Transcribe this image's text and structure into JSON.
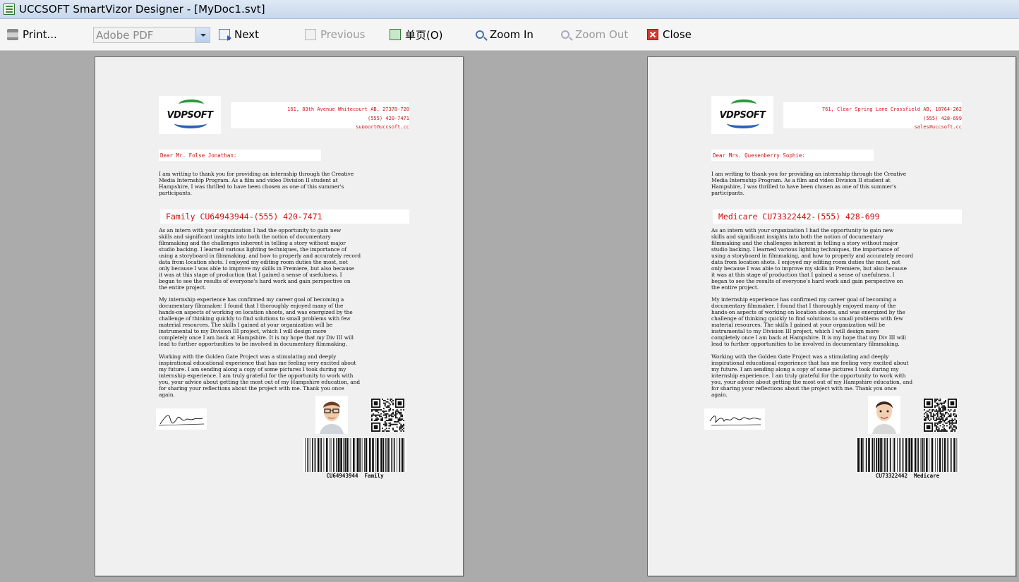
{
  "window": {
    "title": "UCCSOFT SmartVizor Designer - [MyDoc1.svt]"
  },
  "toolbar": {
    "print_label": "Print...",
    "printer_value": "Adobe PDF",
    "next_label": "Next",
    "previous_label": "Previous",
    "single_page_label": "单页(O)",
    "zoom_in_label": "Zoom In",
    "zoom_out_label": "Zoom Out",
    "close_label": "Close"
  },
  "letter": {
    "logo_text": "VDPSOFT",
    "para1": "I am writing to thank you for providing an internship through the Creative\nMedia Internship Program. As a film and video Division II student at\nHampshire, I was thrilled to have been chosen as one of this summer's\nparticipants.",
    "para2": "As an intern with your organization I had the opportunity to gain new\nskills and significant insights into both the notion of documentary\nfilmmaking and the challenges inherent in telling a story without major\nstudio backing. I learned various lighting techniques, the importance of\nusing a storyboard in filmmaking, and how to properly and accurately record\ndata from location shots.  I enjoyed my editing room duties the most, not\nonly because I was able to improve my skills in Premiere, but also because\nit was at this stage of production that I gained a sense of usefulness. I\nbegan to see the results of everyone's hard work and gain perspective on\nthe entire project.",
    "para3": "My internship experience has confirmed my career goal of becoming a\ndocumentary filmmaker. I found that I thoroughly enjoyed many of the\nhands-on aspects of working on location shoots, and was energized by the\nchallenge of thinking quickly to find solutions to small problems with few\nmaterial resources. The skills I gained at your organization will be\ninstrumental to my Division III project, which I will design more\ncompletely once I am back at Hampshire. It is my hope that my Div III will\nlead to further opportunities to be involved in documentary filmmaking.",
    "para4": "Working with the Golden Gate Project was a stimulating and deeply\ninspirational educational experience that has me feeling very excited about\nmy future.  I am sending along a copy of some pictures I took during my\ninternship experience. I am truly grateful for the opportunity to work with\nyou, your advice about getting the most out of my Hampshire education, and\nfor sharing your reflections about the project with me.  Thank you once\nagain."
  },
  "pages": [
    {
      "address": "161, 83th Avenue Whitecourt AB, 27378-720",
      "phone": "(555) 420-7471",
      "email": "support@uccsoft.cc",
      "salutation": "Dear Mr. Folse Jonathan:",
      "id_line": "Family CU64943944-(555) 420-7471",
      "barcode_text": "CU64943944  Family"
    },
    {
      "address": "761, Clear Spring Lane Crossfield AB, 18764-262",
      "phone": "(555) 428-699",
      "email": "sales@uccsoft.cc",
      "salutation": "Dear Mrs. Quesenberry Sophie:",
      "id_line": "Medicare CU73322442-(555) 428-699",
      "barcode_text": "CU73322442  Medicare"
    }
  ]
}
